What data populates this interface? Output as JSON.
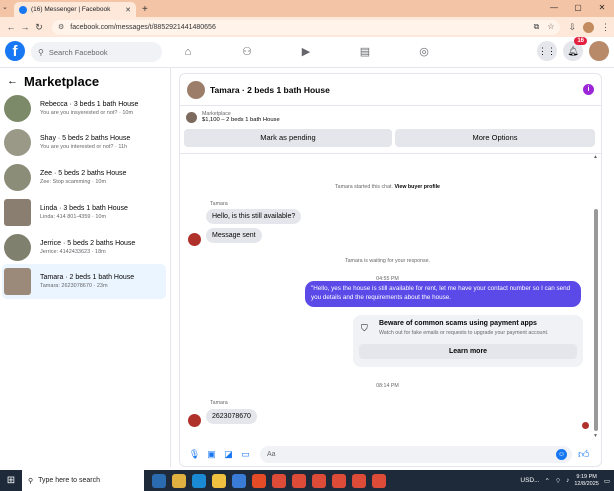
{
  "browser": {
    "tab_title": "(16) Messenger | Facebook",
    "tab_close": "✕",
    "new_tab": "+",
    "url": "facebook.com/messages/t/8852921441480656",
    "window_controls": [
      "—",
      "▢",
      "✕"
    ],
    "tab_dropdown": "⌄"
  },
  "fb_nav": {
    "logo": "f",
    "search_placeholder": "Search Facebook",
    "notification_count": "16"
  },
  "sidebar": {
    "title": "Marketplace",
    "items": [
      {
        "name": "Rebecca · 3 beds 1 bath House",
        "preview": "You are you insyerested or not? · 10m"
      },
      {
        "name": "Shay · 5 beds 2 baths House",
        "preview": "You are you interested or not? · 11h"
      },
      {
        "name": "Zee · 5 beds 2 baths House",
        "preview": "Zee: Stop scamming · 10m"
      },
      {
        "name": "Linda · 3 beds 1 bath House",
        "preview": "Linda: 414 801-4359 · 10m"
      },
      {
        "name": "Jerrice · 5 beds 2 baths House",
        "preview": "Jerrice: 4142433623 · 18m"
      },
      {
        "name": "Tamara · 2 beds 1 bath House",
        "preview": "Tamara: 2623078670 · 23m"
      }
    ]
  },
  "chat": {
    "header_title": "Tamara · 2 beds 1 bath House",
    "listing_label": "Marketplace",
    "listing_value": "$1,100 – 2 beds 1 bath House",
    "mark_pending": "Mark as pending",
    "more_options": "More Options",
    "started_text": "Tamara started this chat.",
    "view_buyer": "View buyer profile",
    "sender_name": "Tamara",
    "msg1": "Hello, is this still available?",
    "msg2": "Message sent",
    "waiting_text": "Tamara is waiting for your response.",
    "time1": "04:55 PM",
    "outgoing": "\"Hello, yes the house is still available for rent, let me have your contact number so I can send you details and the requirements about the house.",
    "scam_title": "Beware of common scams using payment apps",
    "scam_desc": "Watch out for fake emails or requests to upgrade your payment account.",
    "learn_more": "Learn more",
    "time2": "08:14 PM",
    "sender_name2": "Tamara",
    "msg3": "2623078670",
    "compose_placeholder": "Aa"
  },
  "taskbar": {
    "search_placeholder": "Type here to search",
    "currency": "USD...",
    "time": "9:19 PM",
    "date": "12/8/2025"
  }
}
